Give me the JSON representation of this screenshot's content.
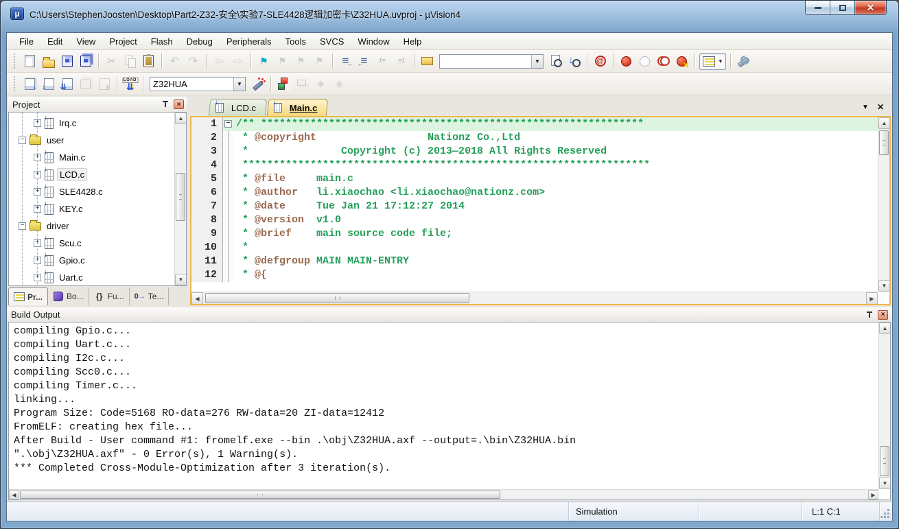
{
  "window": {
    "title": "C:\\Users\\StephenJoosten\\Desktop\\Part2-Z32-安全\\实验7-SLE4428逻辑加密卡\\Z32HUA.uvproj - µVision4"
  },
  "menu": {
    "items": [
      "File",
      "Edit",
      "View",
      "Project",
      "Flash",
      "Debug",
      "Peripherals",
      "Tools",
      "SVCS",
      "Window",
      "Help"
    ]
  },
  "toolbar_main": {
    "groups": [
      [
        {
          "name": "new-file",
          "en": true
        },
        {
          "name": "open-file",
          "en": true
        },
        {
          "name": "save",
          "en": true
        },
        {
          "name": "save-all",
          "en": true
        }
      ],
      [
        {
          "name": "cut",
          "en": false
        },
        {
          "name": "copy",
          "en": false
        },
        {
          "name": "paste",
          "en": true
        }
      ],
      [
        {
          "name": "undo",
          "en": false
        },
        {
          "name": "redo",
          "en": false
        }
      ],
      [
        {
          "name": "nav-back",
          "en": false
        },
        {
          "name": "nav-forward",
          "en": false
        }
      ],
      [
        {
          "name": "bookmark",
          "en": true
        },
        {
          "name": "bookmark-prev",
          "en": false
        },
        {
          "name": "bookmark-next",
          "en": false
        },
        {
          "name": "bookmark-clear",
          "en": false
        }
      ],
      [
        {
          "name": "indent",
          "en": true
        },
        {
          "name": "unindent",
          "en": true
        },
        {
          "name": "comment",
          "en": false
        },
        {
          "name": "uncomment",
          "en": false
        }
      ],
      [
        {
          "name": "find-in-files",
          "en": true
        },
        {
          "type": "combo",
          "name": "search-combobox",
          "value": "",
          "width": 150
        },
        {
          "name": "find",
          "en": true,
          "mag": true
        },
        {
          "name": "incremental-find",
          "en": true,
          "mag": true
        }
      ],
      [
        {
          "name": "debug-session",
          "en": true
        }
      ],
      [
        {
          "name": "insert-breakpoint",
          "en": true
        },
        {
          "name": "disable-breakpoint",
          "en": true
        },
        {
          "name": "disable-all-breakpoints",
          "en": true
        },
        {
          "name": "kill-all-breakpoints",
          "en": true
        }
      ],
      [
        {
          "name": "window-views",
          "en": true,
          "drop": true,
          "pressed": true
        }
      ],
      [
        {
          "name": "configure",
          "en": true
        }
      ]
    ]
  },
  "toolbar_build": {
    "groups": [
      [
        {
          "name": "translate",
          "en": true
        },
        {
          "name": "build",
          "en": true
        },
        {
          "name": "rebuild",
          "en": true
        },
        {
          "name": "batch-build",
          "en": false
        },
        {
          "name": "stop-build",
          "en": false
        }
      ],
      [
        {
          "name": "download",
          "en": true
        }
      ],
      [
        {
          "type": "combo",
          "name": "target-select",
          "value": "Z32HUA",
          "width": 138
        },
        {
          "name": "target-options",
          "en": true
        }
      ],
      [
        {
          "name": "manage-rte",
          "en": true
        },
        {
          "name": "multi-project",
          "en": false
        },
        {
          "name": "pack-installer",
          "en": false
        },
        {
          "name": "manage-packs",
          "en": false
        }
      ]
    ]
  },
  "project_panel": {
    "title": "Project",
    "tree": [
      {
        "label": "Irq.c",
        "kind": "cfile",
        "level": 2,
        "toggle": "plus"
      },
      {
        "label": "user",
        "kind": "folder",
        "level": 1,
        "toggle": "minus"
      },
      {
        "label": "Main.c",
        "kind": "cfile",
        "level": 2,
        "toggle": "plus"
      },
      {
        "label": "LCD.c",
        "kind": "cfile",
        "level": 2,
        "toggle": "plus",
        "selected": true
      },
      {
        "label": "SLE4428.c",
        "kind": "cfile",
        "level": 2,
        "toggle": "plus"
      },
      {
        "label": "KEY.c",
        "kind": "cfile",
        "level": 2,
        "toggle": "plus"
      },
      {
        "label": "driver",
        "kind": "folder",
        "level": 1,
        "toggle": "minus"
      },
      {
        "label": "Scu.c",
        "kind": "cfile",
        "level": 2,
        "toggle": "plus"
      },
      {
        "label": "Gpio.c",
        "kind": "cfile",
        "level": 2,
        "toggle": "plus"
      },
      {
        "label": "Uart.c",
        "kind": "cfile",
        "level": 2,
        "toggle": "plus"
      }
    ],
    "tabs": [
      {
        "label": "Pr...",
        "icon": "project",
        "active": true
      },
      {
        "label": "Bo...",
        "icon": "books",
        "active": false
      },
      {
        "label": "Fu...",
        "icon": "functions",
        "active": false
      },
      {
        "label": "Te...",
        "icon": "templates",
        "active": false
      }
    ]
  },
  "editor": {
    "tabs": [
      {
        "label": "LCD.c",
        "active": false
      },
      {
        "label": "Main.c",
        "active": true
      }
    ],
    "lines": [
      {
        "n": 1,
        "fold": "minus",
        "hl": true,
        "segs": [
          {
            "c": "g",
            "t": "/** **************************************************************"
          }
        ]
      },
      {
        "n": 2,
        "fold": "line",
        "segs": [
          {
            "c": "g",
            "t": " * "
          },
          {
            "c": "t",
            "t": "@copyright"
          },
          {
            "c": "g",
            "t": "                  Nationz Co.,Ltd"
          }
        ]
      },
      {
        "n": 3,
        "fold": "line",
        "segs": [
          {
            "c": "g",
            "t": " *               Copyright (c) 2013—2018 All Rights Reserved"
          }
        ]
      },
      {
        "n": 4,
        "fold": "line",
        "segs": [
          {
            "c": "g",
            "t": " ******************************************************************"
          }
        ]
      },
      {
        "n": 5,
        "fold": "line",
        "segs": [
          {
            "c": "g",
            "t": " * "
          },
          {
            "c": "t",
            "t": "@file"
          },
          {
            "c": "g",
            "t": "     main.c"
          }
        ]
      },
      {
        "n": 6,
        "fold": "line",
        "segs": [
          {
            "c": "g",
            "t": " * "
          },
          {
            "c": "t",
            "t": "@author"
          },
          {
            "c": "g",
            "t": "   li.xiaochao <li.xiaochao@nationz.com>"
          }
        ]
      },
      {
        "n": 7,
        "fold": "line",
        "segs": [
          {
            "c": "g",
            "t": " * "
          },
          {
            "c": "t",
            "t": "@date"
          },
          {
            "c": "g",
            "t": "     Tue Jan 21 17:12:27 2014"
          }
        ]
      },
      {
        "n": 8,
        "fold": "line",
        "segs": [
          {
            "c": "g",
            "t": " * "
          },
          {
            "c": "t",
            "t": "@version"
          },
          {
            "c": "g",
            "t": "  v1.0"
          }
        ]
      },
      {
        "n": 9,
        "fold": "line",
        "segs": [
          {
            "c": "g",
            "t": " * "
          },
          {
            "c": "t",
            "t": "@brief"
          },
          {
            "c": "g",
            "t": "    main source code file;"
          }
        ]
      },
      {
        "n": 10,
        "fold": "line",
        "segs": [
          {
            "c": "g",
            "t": " *"
          }
        ]
      },
      {
        "n": 11,
        "fold": "line",
        "segs": [
          {
            "c": "g",
            "t": " * "
          },
          {
            "c": "t",
            "t": "@defgroup"
          },
          {
            "c": "g",
            "t": " MAIN MAIN-ENTRY"
          }
        ]
      },
      {
        "n": 12,
        "fold": "line",
        "segs": [
          {
            "c": "g",
            "t": " * "
          },
          {
            "c": "t",
            "t": "@{"
          }
        ]
      }
    ]
  },
  "build_output": {
    "title": "Build Output",
    "lines": [
      "compiling Gpio.c...",
      "compiling Uart.c...",
      "compiling I2c.c...",
      "compiling Scc0.c...",
      "compiling Timer.c...",
      "linking...",
      "Program Size: Code=5168 RO-data=276 RW-data=20 ZI-data=12412",
      "FromELF: creating hex file...",
      "After Build - User command #1: fromelf.exe --bin .\\obj\\Z32HUA.axf --output=.\\bin\\Z32HUA.bin",
      "\".\\obj\\Z32HUA.axf\" - 0 Error(s), 1 Warning(s).",
      "*** Completed Cross-Module-Optimization after 3 iteration(s)."
    ]
  },
  "status_bar": {
    "mode": "Simulation",
    "cursor": "L:1 C:1"
  }
}
